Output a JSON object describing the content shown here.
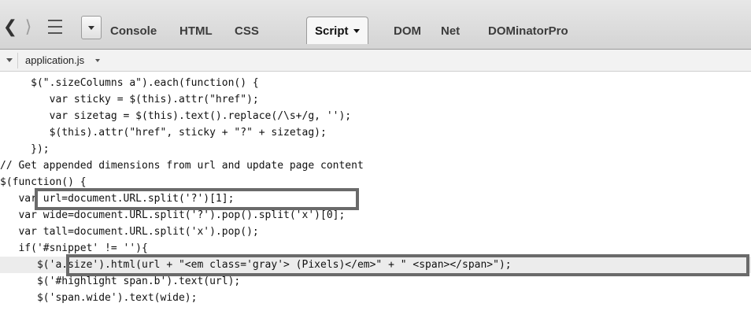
{
  "toolbar": {
    "back_glyph": "❮",
    "forward_glyph": "⟩",
    "tabs": [
      {
        "label": "Console"
      },
      {
        "label": "HTML"
      },
      {
        "label": "CSS"
      },
      {
        "label": "Script"
      },
      {
        "label": "DOM"
      },
      {
        "label": "Net"
      },
      {
        "label": "DOMinatorPro"
      }
    ]
  },
  "file": {
    "name": "application.js"
  },
  "code_lines": [
    "     $(\".sizeColumns a\").each(function() {",
    "        var sticky = $(this).attr(\"href\");",
    "        var sizetag = $(this).text().replace(/\\s+/g, '');",
    "        $(this).attr(\"href\", sticky + \"?\" + sizetag);",
    "     });",
    "// Get appended dimensions from url and update page content",
    "$(function() {",
    "   var url=document.URL.split('?')[1];",
    "   var wide=document.URL.split('?').pop().split('x')[0];",
    "   var tall=document.URL.split('x').pop();",
    "   if('#snippet' != ''){",
    "      $('a.size').html(url + \"<em class='gray'> (Pixels)</em>\" + \" <span></span>\");",
    "      $('#highlight span.b').text(url);",
    "      $('span.wide').text(wide);"
  ]
}
